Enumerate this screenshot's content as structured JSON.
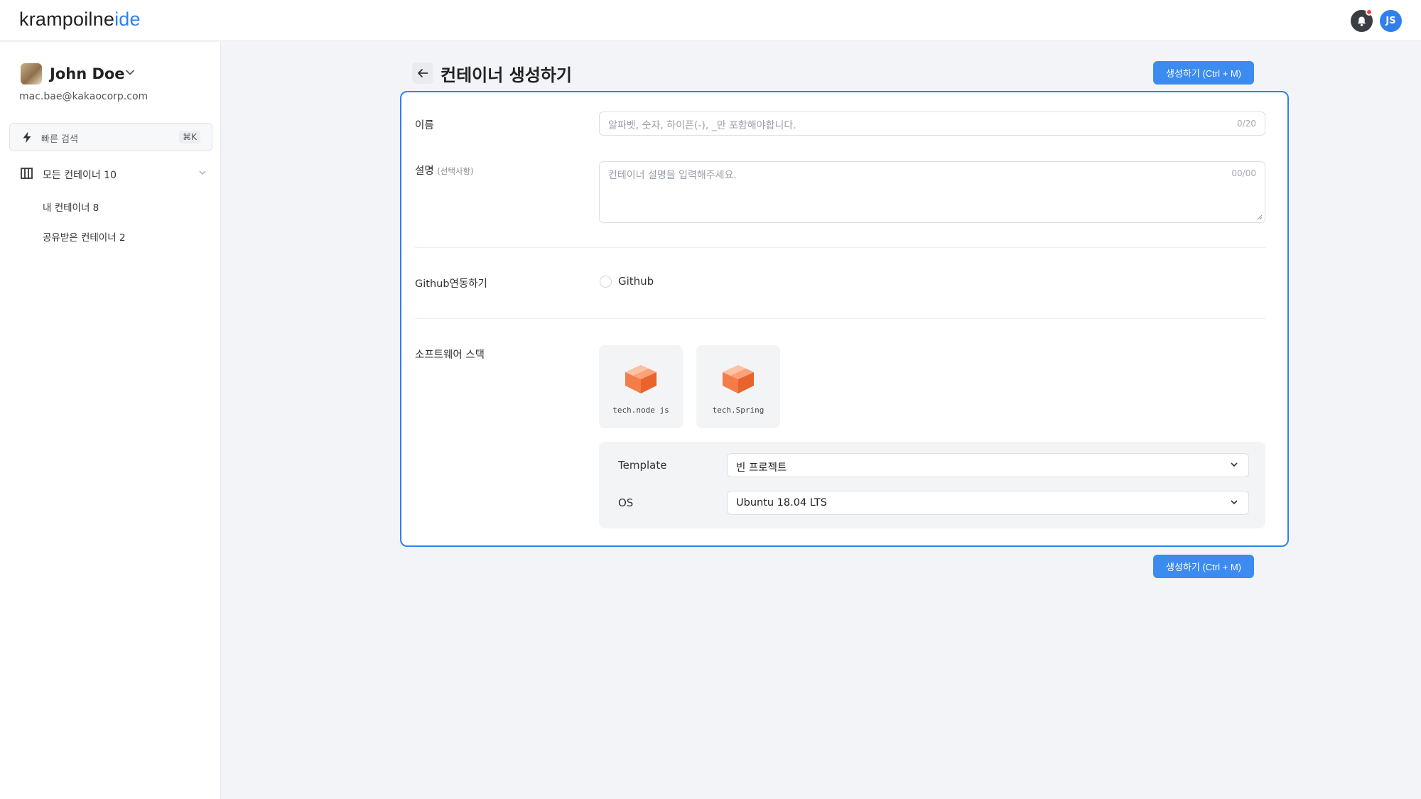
{
  "app": {
    "logo_part1": "krampoilne",
    "logo_part2": "ide",
    "header_avatar_initials": "JS"
  },
  "sidebar": {
    "user_name": "John Doe",
    "user_email": "mac.bae@kakaocorp.com",
    "quick_search_label": "빠른 검색",
    "quick_search_shortcut": "⌘K",
    "nav_all": "모든 컨테이너 10",
    "nav_mine": "내 컨테이너 8",
    "nav_shared": "공유받은 컨테이너 2"
  },
  "page": {
    "title": "컨테이너 생성하기",
    "create_button": "생성하기 (Ctrl + M)"
  },
  "form": {
    "name_label": "이름",
    "name_placeholder": "알파벳, 숫자, 하이픈(-), _만 포함해야합니다.",
    "name_counter": "0/20",
    "desc_label": "설명",
    "desc_optional": "(선택사항)",
    "desc_placeholder": "컨테이너 설명을 입력해주세요.",
    "desc_counter": "00/00",
    "github_label": "Github연동하기",
    "github_option": "Github",
    "stack_label": "소프트웨어 스택",
    "tech": [
      {
        "label": "tech.node js",
        "icon": "package-box-icon"
      },
      {
        "label": "tech.Spring",
        "icon": "package-box-icon"
      }
    ],
    "template_label": "Template",
    "template_value": "빈 프로젝트",
    "os_label": "OS",
    "os_value": "Ubuntu 18.04 LTS"
  },
  "colors": {
    "accent": "#2f80ed",
    "button": "#3b8bf0",
    "notification_dot": "#ef4444",
    "box_icon": "#f47c48"
  }
}
